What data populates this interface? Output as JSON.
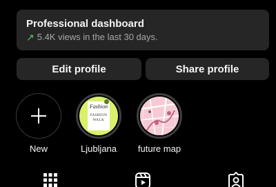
{
  "dashboard": {
    "title": "Professional dashboard",
    "subtitle": "5.4K views in the last 30 days.",
    "trend_icon": "trend-up-arrow-icon",
    "trend_color": "#4fce6b"
  },
  "buttons": {
    "edit_label": "Edit profile",
    "share_label": "Share profile"
  },
  "highlights": [
    {
      "label": "New",
      "icon": "plus-icon"
    },
    {
      "label": "Ljubljana",
      "cover_lines": [
        "Fashion",
        "FASHION",
        "WALK"
      ]
    },
    {
      "label": "future map",
      "icon": "map-thumbnail"
    }
  ],
  "tabs": [
    {
      "icon": "grid-icon",
      "active": true
    },
    {
      "icon": "reels-icon",
      "active": false
    },
    {
      "icon": "tagged-icon",
      "active": false
    }
  ],
  "colors": {
    "background": "#000000",
    "card": "#262626",
    "text_secondary": "#a8a8a8"
  }
}
